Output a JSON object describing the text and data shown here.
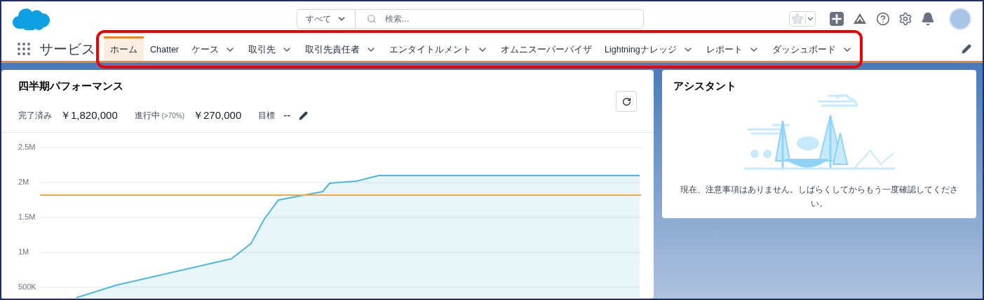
{
  "app_name": "サービス",
  "search": {
    "scope": "すべて",
    "placeholder": "検索..."
  },
  "tabs": [
    {
      "label": "ホーム",
      "selected": true,
      "dropdown": false
    },
    {
      "label": "Chatter",
      "selected": false,
      "dropdown": false
    },
    {
      "label": "ケース",
      "selected": false,
      "dropdown": true
    },
    {
      "label": "取引先",
      "selected": false,
      "dropdown": true
    },
    {
      "label": "取引先責任者",
      "selected": false,
      "dropdown": true
    },
    {
      "label": "エンタイトルメント",
      "selected": false,
      "dropdown": true
    },
    {
      "label": "オムニスーパーバイザ",
      "selected": false,
      "dropdown": false
    },
    {
      "label": "Lightningナレッジ",
      "selected": false,
      "dropdown": true
    },
    {
      "label": "レポート",
      "selected": false,
      "dropdown": true
    },
    {
      "label": "ダッシュボード",
      "selected": false,
      "dropdown": true
    }
  ],
  "performance": {
    "title": "四半期パフォーマンス",
    "stats": [
      {
        "label": "完了済み",
        "value": "￥1,820,000"
      },
      {
        "label": "進行中",
        "note": "(>70%)",
        "value": "￥270,000"
      },
      {
        "label": "目標",
        "value": "--"
      }
    ],
    "y_axis_labels": [
      "2.5M",
      "2M",
      "1.5M",
      "1M",
      "500K"
    ]
  },
  "assistant": {
    "title": "アシスタント",
    "message": "現在、注意事項はありません。しばらくしてからもう一度確認してください。"
  }
}
